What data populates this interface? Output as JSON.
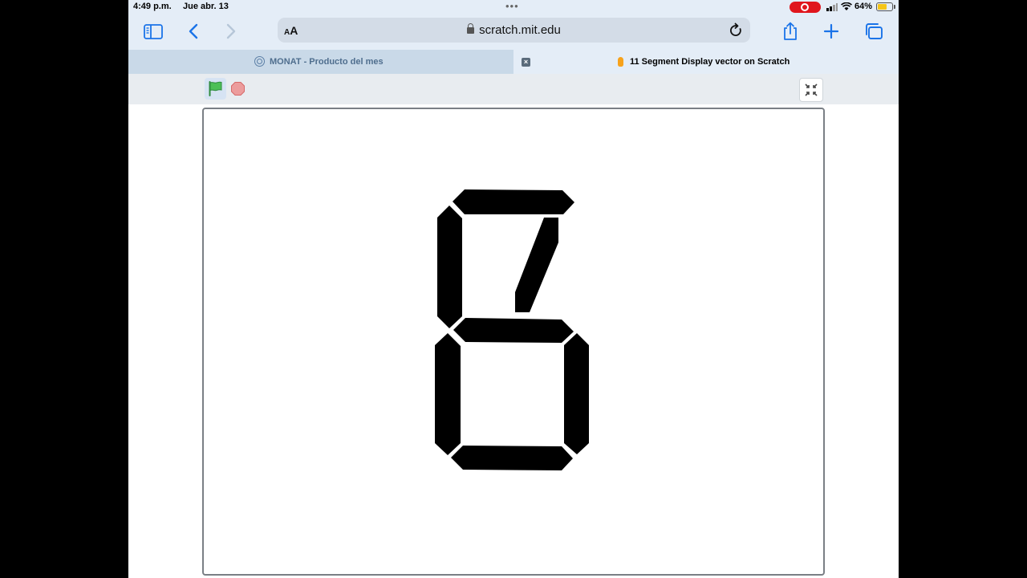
{
  "status_bar": {
    "time": "4:49 p.m.",
    "date": "Jue abr. 13",
    "battery_percent": "64%",
    "battery_level": 0.64
  },
  "toolbar": {
    "text_size_label_small": "A",
    "text_size_label_large": "A",
    "url": "scratch.mit.edu",
    "accent_color": "#1a73e8"
  },
  "tabs": [
    {
      "label": "MONAT - Producto del mes",
      "active": false,
      "favicon": "monat-ring-icon"
    },
    {
      "label": "11 Segment Display vector on Scratch",
      "active": true,
      "favicon": "scratch-cat-icon"
    }
  ],
  "tab_close_glyph": "×",
  "stage": {
    "display": {
      "segments_lit": [
        "top",
        "upper-left",
        "diagonal-upper-right",
        "middle",
        "lower-left",
        "lower-right",
        "bottom"
      ],
      "segment_color": "#000000"
    }
  }
}
